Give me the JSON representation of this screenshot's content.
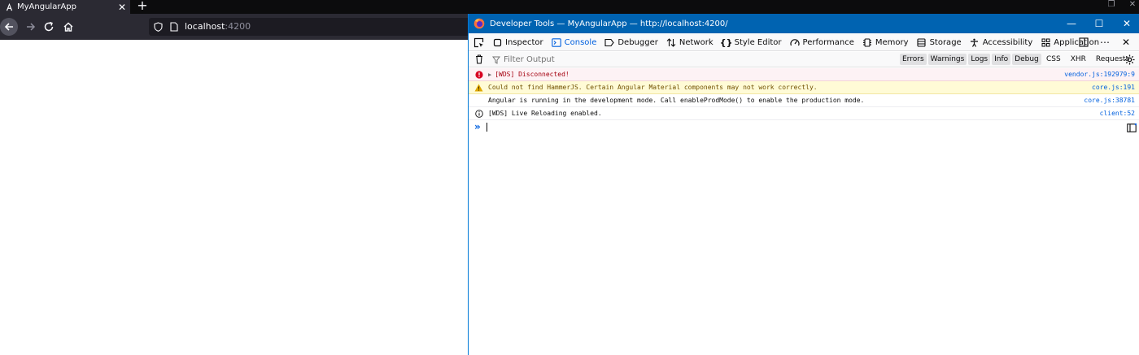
{
  "browser": {
    "tab": {
      "title": "MyAngularApp",
      "close_glyph": "✕"
    },
    "new_tab_glyph": "+",
    "window_controls": {
      "restore_glyph": "❐",
      "close_glyph": "✕"
    },
    "url": {
      "host": "localhost",
      "port": ":4200"
    },
    "icons": [
      "angular-favicon",
      "back-arrow-icon",
      "forward-arrow-icon",
      "reload-icon",
      "home-icon",
      "shield-icon",
      "page-icon"
    ]
  },
  "devtools": {
    "title": "Developer Tools — MyAngularApp — http://localhost:4200/",
    "window_controls": {
      "minimize": "—",
      "maximize": "☐",
      "close": "✕"
    },
    "tabs": [
      {
        "label": "Inspector",
        "icon": "inspector-icon"
      },
      {
        "label": "Console",
        "icon": "console-icon",
        "active": true
      },
      {
        "label": "Debugger",
        "icon": "debugger-icon"
      },
      {
        "label": "Network",
        "icon": "network-icon"
      },
      {
        "label": "Style Editor",
        "icon": "style-editor-icon"
      },
      {
        "label": "Performance",
        "icon": "performance-icon"
      },
      {
        "label": "Memory",
        "icon": "memory-icon"
      },
      {
        "label": "Storage",
        "icon": "storage-icon"
      },
      {
        "label": "Accessibility",
        "icon": "accessibility-icon"
      },
      {
        "label": "Application",
        "icon": "application-icon"
      }
    ],
    "toolbar_right": {
      "more_glyph": "⋯",
      "close_glyph": "✕"
    },
    "filter": {
      "placeholder": "Filter Output"
    },
    "levels": [
      "Errors",
      "Warnings",
      "Logs",
      "Info",
      "Debug"
    ],
    "kinds": [
      "CSS",
      "XHR",
      "Requests"
    ],
    "messages": [
      {
        "level": "error",
        "text": "[WDS] Disconnected!",
        "source": "vendor.js:192979:9"
      },
      {
        "level": "warn",
        "text": "Could not find HammerJS. Certain Angular Material components may not work correctly.",
        "source": "core.js:191"
      },
      {
        "level": "log",
        "text": "Angular is running in the development mode. Call enableProdMode() to enable the production mode.",
        "source": "core.js:38781"
      },
      {
        "level": "info",
        "text": "[WDS] Live Reloading enabled.",
        "source": "client:52"
      }
    ],
    "prompt_glyph": "»",
    "colors": {
      "titlebar": "#0063b1",
      "accent": "#0060df",
      "error_bg": "#fdf2f5",
      "warn_bg": "#fffbd6"
    }
  }
}
